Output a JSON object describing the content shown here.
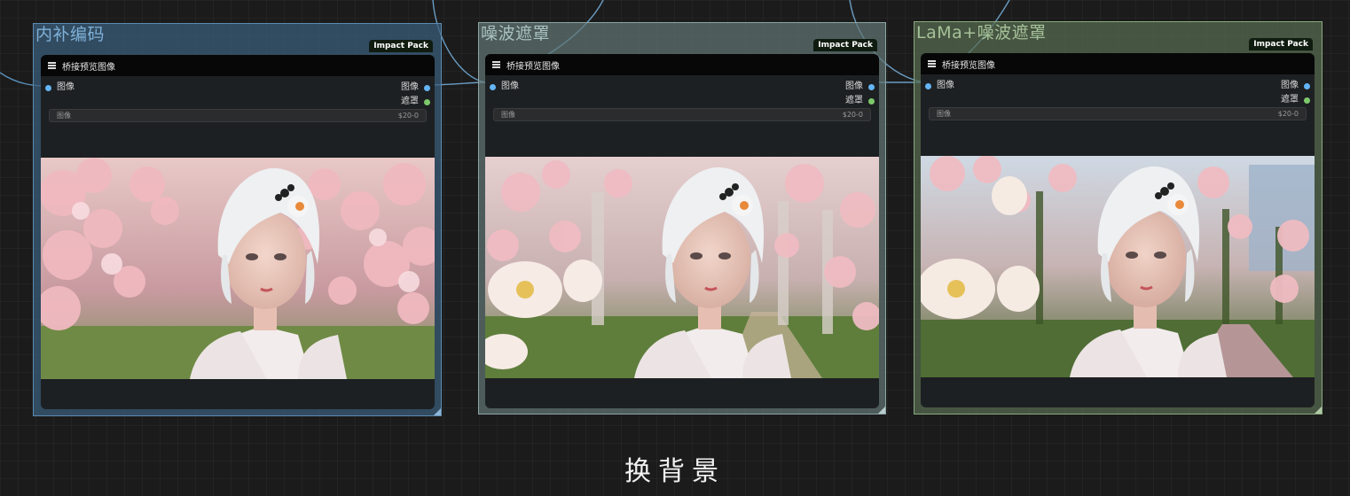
{
  "groups": [
    {
      "title": "内补编码",
      "badge": "Impact Pack",
      "node_title": "桥接预览图像",
      "input_label": "图像",
      "output_image_label": "图像",
      "output_mask_label": "遮罩",
      "widget_label": "图像",
      "widget_value": "$20-0"
    },
    {
      "title": "噪波遮罩",
      "badge": "Impact Pack",
      "node_title": "桥接预览图像",
      "input_label": "图像",
      "output_image_label": "图像",
      "output_mask_label": "遮罩",
      "widget_label": "图像",
      "widget_value": "$20-0"
    },
    {
      "title": "LaMa+噪波遮罩",
      "badge": "Impact Pack",
      "node_title": "桥接预览图像",
      "input_label": "图像",
      "output_image_label": "图像",
      "output_mask_label": "遮罩",
      "widget_label": "图像",
      "widget_value": "$20-0"
    }
  ],
  "caption": "换背景",
  "colors": {
    "canvas_bg": "#1b1b1b",
    "group1": "#3a5e7d",
    "group2": "#617675",
    "group3": "#576c50",
    "image_port": "#64b5f6",
    "mask_port": "#7cc96a"
  },
  "icons": {
    "node_menu": "hamburger-menu-icon",
    "resize": "resize-corner-icon"
  }
}
